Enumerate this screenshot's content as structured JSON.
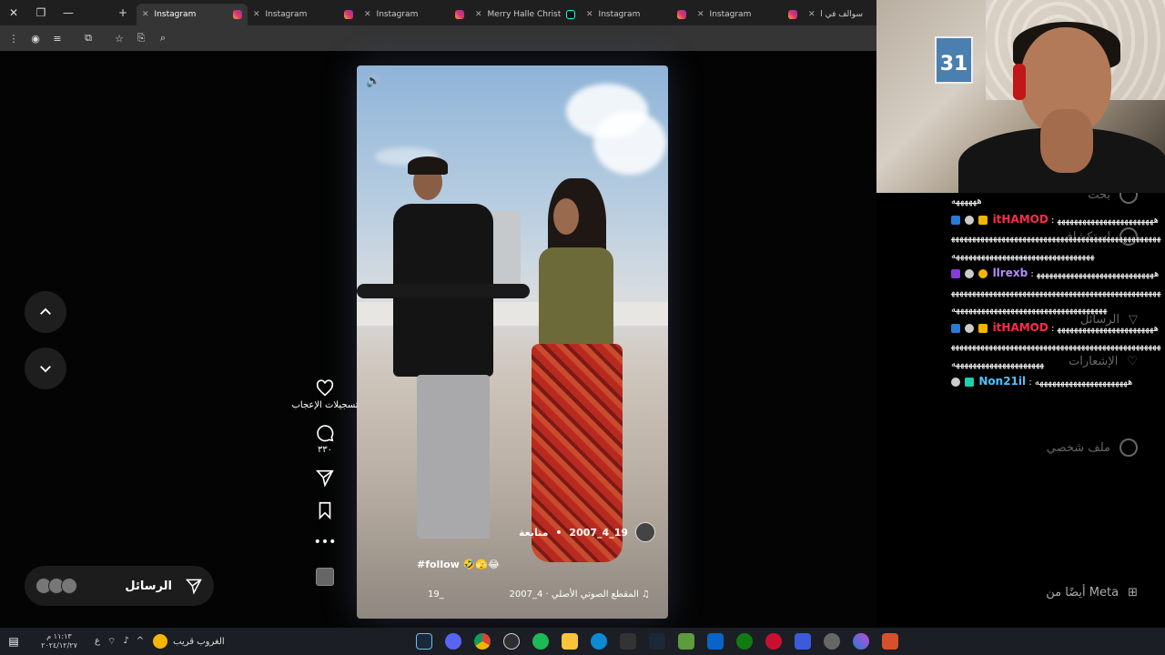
{
  "tabs": [
    {
      "label": "Instagram",
      "active": true,
      "favicon": "instagram-icon"
    },
    {
      "label": "Instagram",
      "active": false,
      "favicon": "instagram-icon"
    },
    {
      "label": "Instagram",
      "active": false,
      "favicon": "instagram-icon"
    },
    {
      "label": "Merry Halle Christmas",
      "active": false,
      "favicon": "tiktok-icon"
    },
    {
      "label": "Instagram",
      "active": false,
      "favicon": "instagram-icon"
    },
    {
      "label": "Instagram",
      "active": false,
      "favicon": "instagram-icon"
    },
    {
      "label": "سوالف في الدا",
      "active": false,
      "favicon": "instagram-icon"
    }
  ],
  "reel": {
    "username": "2007_4_19",
    "follow_label": "متابعة",
    "caption": "#follow 🤣🫣😂",
    "audio": "2007_4 · المقطع الصوتي الأصلي",
    "audio_user": "19_"
  },
  "actions": {
    "likes_label": "تسجيلات الإعجاب",
    "comments_count": "٣٣٠"
  },
  "messages_pill": {
    "label": "الرسائل"
  },
  "sidebar_nav": {
    "search": "بحث",
    "explore": "استكشاف",
    "messages": "الرسائل",
    "notifications": "الإشعارات",
    "profile": "ملف شخصي",
    "meta": "أيضًا من Meta"
  },
  "chat": [
    {
      "user": "",
      "text": "ههههههه"
    },
    {
      "user": "itHAMOD",
      "color": "#ff2b4b",
      "text": "هههههههههههههههههههههههههههههههههههههههههههههههههههههههههههههههههههههههههههههههههههههههههههههههههههههههههههه"
    },
    {
      "user": "llrexb",
      "color": "#b38cff",
      "text": "هههههههههههههههههههههههههههههههههههههههههههههههههههههههههههههههههههههههههههههههههههههههههههههههههههههههههههههههههههه"
    },
    {
      "user": "itHAMOD",
      "color": "#ff2b4b",
      "text": "هههههههههههههههههههههههههههههههههههههههههههههههههههههههههههههههههههههههههههههههههههههههههههههههه"
    },
    {
      "user": "Non21il",
      "color": "#4fc3ff",
      "text": "ههههههههههههههههههههههه"
    }
  ],
  "taskbar": {
    "time": "١١:١٣ م",
    "date": "٢٠٢٤/١٢/٢٧",
    "lang": "ع",
    "weather": "الغروب قريب"
  },
  "colors": {
    "accent_red": "#ff2b4b",
    "bg": "#000000"
  }
}
